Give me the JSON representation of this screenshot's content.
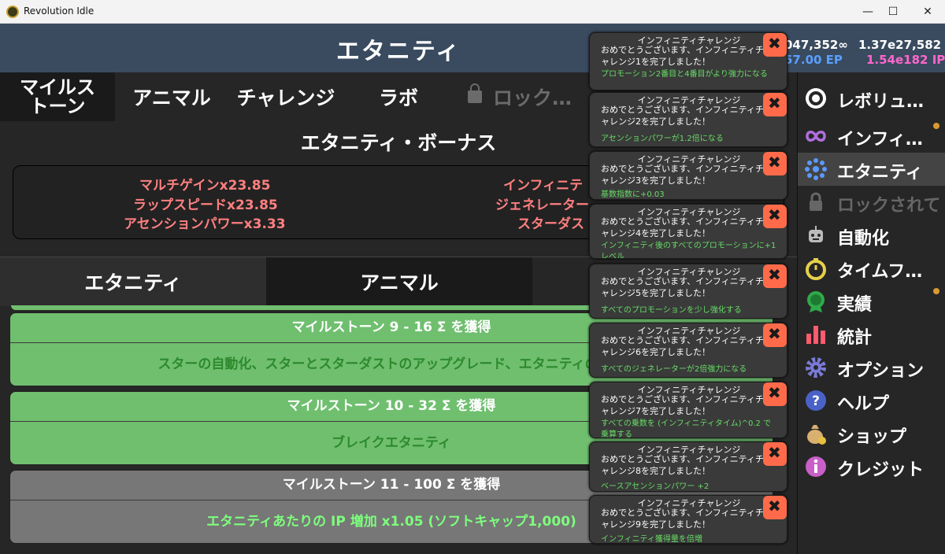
{
  "window": {
    "title": "Revolution Idle",
    "min": "—",
    "max": "☐",
    "close": "✕"
  },
  "header": {
    "title": "エタニティ",
    "currency_left": "047,352∞",
    "currency_right": "1.37e27,582 ⊙",
    "rate_left": "57.00 EP",
    "rate_right": "1.54e182 IP"
  },
  "top_tabs": {
    "milestone": "マイルス トーン",
    "animal": "アニマル",
    "challenge": "チャレンジ",
    "lab": "ラボ",
    "locked": "ロック…"
  },
  "bonus": {
    "title": "エタニティ・ボーナス",
    "left": [
      "マルチゲインx23.85",
      "ラップスピードx23.85",
      "アセンションパワーx3.33"
    ],
    "right": [
      "インフィニテ",
      "ジェネレーター",
      "スターダス"
    ]
  },
  "sub_tabs": {
    "eternity": "エタニティ",
    "animal": "アニマル"
  },
  "milestones": [
    {
      "title": "マイルストーン 9 - 16 Σ を獲得",
      "desc": "スターの自動化、スターとスターダストのアップグレード、エタニティの自動",
      "done": true
    },
    {
      "title": "マイルストーン 10 - 32 Σ を獲得",
      "desc": "ブレイクエタニティ",
      "done": true
    },
    {
      "title": "マイルストーン 11 - 100 Σ を獲得",
      "desc": "エタニティあたりの IP 増加 x1.05 (ソフトキャップ1,000)",
      "done": false
    }
  ],
  "sidebar": [
    {
      "label": "レボリュ…",
      "icon": "revolution-icon",
      "dot": false
    },
    {
      "label": "インフィ…",
      "icon": "infinity-icon",
      "dot": true
    },
    {
      "label": "エタニティ",
      "icon": "eternity-icon",
      "dot": false,
      "active": true
    },
    {
      "label": "ロックされて",
      "icon": "lock-icon",
      "dot": false,
      "locked": true
    },
    {
      "label": "自動化",
      "icon": "robot-icon",
      "dot": false
    },
    {
      "label": "タイムフ…",
      "icon": "stopwatch-icon",
      "dot": false
    },
    {
      "label": "実績",
      "icon": "medal-icon",
      "dot": true
    },
    {
      "label": "統計",
      "icon": "bar-chart-icon",
      "dot": false
    },
    {
      "label": "オプション",
      "icon": "gear-icon",
      "dot": false
    },
    {
      "label": "ヘルプ",
      "icon": "help-icon",
      "dot": false
    },
    {
      "label": "ショップ",
      "icon": "money-bag-icon",
      "dot": false
    },
    {
      "label": "クレジット",
      "icon": "info-icon",
      "dot": false
    }
  ],
  "notifications": [
    {
      "title": "インフィニティチャレンジ",
      "msg": "おめでとうございます、インフィニティチャレンジ1を完了しました！",
      "reward": "プロモーション2番目と4番目がより強力になる"
    },
    {
      "title": "インフィニティチャレンジ",
      "msg": "おめでとうございます、インフィニティチャレンジ2を完了しました！",
      "reward": "アセンションパワーが1.2倍になる"
    },
    {
      "title": "インフィニティチャレンジ",
      "msg": "おめでとうございます、インフィニティチャレンジ3を完了しました！",
      "reward": "基数指数に+0.03"
    },
    {
      "title": "インフィニティチャレンジ",
      "msg": "おめでとうございます、インフィニティチャレンジ4を完了しました！",
      "reward": "インフィニティ後のすべてのプロモーションに+1レベル"
    },
    {
      "title": "インフィニティチャレンジ",
      "msg": "おめでとうございます、インフィニティチャレンジ5を完了しました！",
      "reward": "すべてのプロモーションを少し強化する"
    },
    {
      "title": "インフィニティチャレンジ",
      "msg": "おめでとうございます、インフィニティチャレンジ6を完了しました！",
      "reward": "すべてのジェネレーターが2倍強力になる"
    },
    {
      "title": "インフィニティチャレンジ",
      "msg": "おめでとうございます、インフィニティチャレンジ7を完了しました！",
      "reward": "すべての乗数を (インフィニティタイム)^0.2 で乗算する"
    },
    {
      "title": "インフィニティチャレンジ",
      "msg": "おめでとうございます、インフィニティチャレンジ8を完了しました！",
      "reward": "ベースアセンションパワー +2"
    },
    {
      "title": "インフィニティチャレンジ",
      "msg": "おめでとうございます、インフィニティチャレンジ9を完了しました！",
      "reward": "インフィニティ獲得量を倍増"
    }
  ],
  "colors": {
    "header_bg": "#3a4b5f",
    "milestone_done": "#6fbf6f",
    "milestone_pending": "#777777",
    "bonus_text": "#ff8080",
    "close_button": "#ff6b4a",
    "ep_blue": "#5aa0ff",
    "ip_pink": "#ff66cc"
  }
}
